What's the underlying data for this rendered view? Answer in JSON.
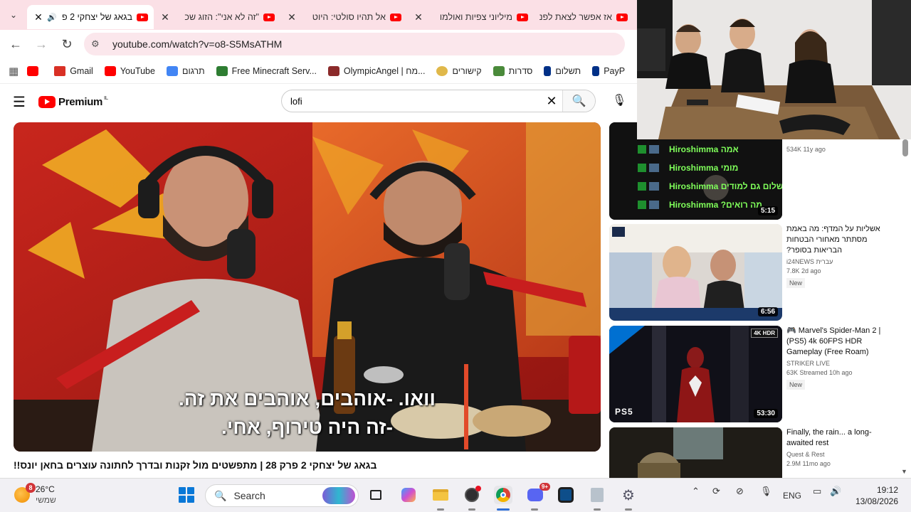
{
  "browser": {
    "tabs": [
      {
        "title": "בגאג של יצחקי 2 פ",
        "active": true,
        "audio": true
      },
      {
        "title": "\"זה לא אני\": הזוג שכ",
        "active": false
      },
      {
        "title": "אל תהיו סולטי: היוט",
        "active": false
      },
      {
        "title": "מיליוני צפיות ואולמו",
        "active": false
      },
      {
        "title": "אז אפשר לצאת לפנ",
        "active": false
      }
    ],
    "url": "youtube.com/watch?v=o8-S5MsATHM",
    "bookmarks": [
      {
        "label": "",
        "color": "#ff0000"
      },
      {
        "label": "Gmail",
        "color": "#d93025"
      },
      {
        "label": "YouTube",
        "color": "#ff0000"
      },
      {
        "label": "תרגום",
        "color": "#4285f4"
      },
      {
        "label": "Free Minecraft Serv...",
        "color": "#2e7d32"
      },
      {
        "label": "OlympicAngel | מח...",
        "color": "#8b2a2a"
      },
      {
        "label": "קישורים",
        "color": "#e0b84a"
      },
      {
        "label": "סדרות",
        "color": "#4a8a3a"
      },
      {
        "label": "תשלום",
        "color": "#003087"
      },
      {
        "label": "PayP",
        "color": "#003087"
      }
    ]
  },
  "youtube": {
    "logo_text": "Premium",
    "logo_region": "IL",
    "search_value": "lofi",
    "video": {
      "subtitle_line1": "וואו. -אוהבים, אוהבים את זה.",
      "subtitle_line2": "-זה היה טירוף, אחי.",
      "title": "בגאג של יצחקי 2 פרק 28 | מתפשטים מול זקנות ובדרך לחתונה עוצרים בחאן יונס!!"
    },
    "top_partial_meta": "534K  11y ago",
    "recommendations": [
      {
        "title": "",
        "channel": "",
        "meta": "",
        "duration": "5:15",
        "badge": "",
        "overlay_lines": [
          "אמה Hiroshimma",
          "מומי Hiroshimma",
          "שלום גם למודים Hiroshimma",
          "מה רואים? Hiroshimma"
        ]
      },
      {
        "title": "אשליות על המדף: מה באמת מסתתר מאחורי הבטחות הבריאות בסופר?",
        "channel": "i24NEWS עברית",
        "meta": "7.8K  2d ago",
        "duration": "6:56",
        "badge": "New"
      },
      {
        "title": "🎮 Marvel's Spider-Man 2 | (PS5) 4k 60FPS HDR Gameplay (Free Roam)",
        "channel": "STRIKER LIVE",
        "meta": "63K  Streamed 10h ago",
        "duration": "53:30",
        "badge": "New",
        "thumb_tag": "4K HDR",
        "thumb_brand": "PS5"
      },
      {
        "title": "Finally, the rain... a long-awaited rest",
        "channel": "Quest & Rest",
        "meta": "2.9M  11mo ago",
        "duration": "",
        "badge": ""
      }
    ]
  },
  "taskbar": {
    "weather_temp": "26°C",
    "weather_desc": "שמשי",
    "weather_badge": "8",
    "search_label": "Search",
    "language": "ENG",
    "time": "19:12",
    "date": "13/08/2026",
    "discord_badge": "9+"
  },
  "colors": {
    "tab_strip": "#fbe0e6",
    "omnibox": "#fbe7ec",
    "youtube_red": "#ff0000",
    "taskbar": "#f1f0f4"
  }
}
